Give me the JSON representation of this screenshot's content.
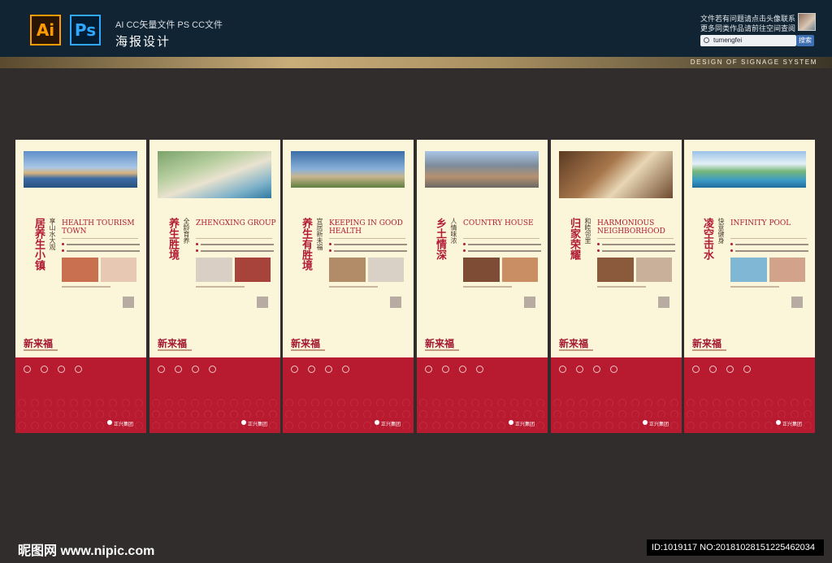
{
  "header": {
    "formats": "AI CC矢量文件   PS CC文件",
    "title": "海报设计",
    "ai_label": "Ai",
    "ps_label": "Ps",
    "note1": "文件若有问题请点击头像联系",
    "note2": "更多同类作品请前往空间查阅",
    "search_value": "tumengfei",
    "search_button": "搜索",
    "band_caption": "DESIGN OF SIGNAGE SYSTEM"
  },
  "posters": [
    {
      "zh": "居养生小镇",
      "sub": "享山水大观",
      "en": "HEALTH TOURISM TOWN",
      "logo": "新来福"
    },
    {
      "zh": "养生胜境",
      "sub": "全龄育养",
      "en": "ZHENGXING GROUP",
      "logo": "新来福"
    },
    {
      "zh": "养生有胜境",
      "sub": "宜居新未福",
      "en": "KEEPING IN GOOD HEALTH",
      "logo": "新来福"
    },
    {
      "zh": "乡土情深",
      "sub": "人情味浓",
      "en": "COUNTRY HOUSE",
      "logo": "新来福"
    },
    {
      "zh": "归家荣耀",
      "sub": "和睦邻里",
      "en": "HARMONIOUS NEIGHBORHOOD",
      "logo": "新来福"
    },
    {
      "zh": "凌空击水",
      "sub": "快意健身",
      "en": "INFINITY POOL",
      "logo": "新来福"
    }
  ],
  "red_brand": "正兴集团",
  "colors": {
    "accent": "#b81a30",
    "cream": "#fbf6d9",
    "background": "#312d2d",
    "header": "#102433"
  },
  "watermark": {
    "left": "昵图网 www.nipic.com",
    "right": "ID:1019117 NO:20181028151225462034"
  }
}
